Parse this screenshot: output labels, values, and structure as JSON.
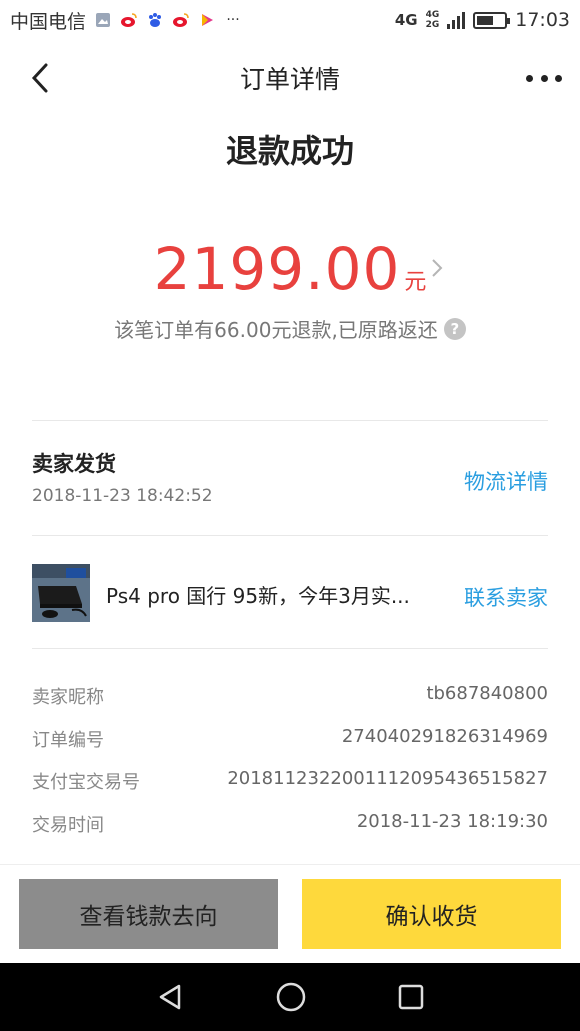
{
  "status_bar": {
    "carrier": "中国电信",
    "network_4g": "4G",
    "network_small_top": "4G",
    "network_small_bottom": "2G",
    "time": "17:03",
    "battery_level": 0.6,
    "notif_icons": [
      "gallery-icon",
      "weibo-icon",
      "baidu-icon",
      "weibo-icon",
      "video-play-icon",
      "more-dots"
    ]
  },
  "nav": {
    "title": "订单详情"
  },
  "order": {
    "status": "退款成功",
    "amount": "2199.00",
    "amount_unit": "元",
    "refund_note": "该笔订单有66.00元退款,已原路返还",
    "help": "?",
    "ship_label": "卖家发货",
    "ship_time": "2018-11-23 18:42:52",
    "logistics_link": "物流详情",
    "product_title": "Ps4 pro 国行 95新，今年3月实...",
    "contact_link": "联系卖家"
  },
  "info": [
    {
      "label": "卖家昵称",
      "value": "tb687840800"
    },
    {
      "label": "订单编号",
      "value": "274040291826314969"
    },
    {
      "label": "支付宝交易号",
      "value": "2018112322001112095436515827"
    },
    {
      "label": "交易时间",
      "value": "2018-11-23 18:19:30"
    }
  ],
  "buttons": {
    "view_funds": "查看钱款去向",
    "confirm_receipt": "确认收货"
  },
  "colors": {
    "accent_red": "#e8413e",
    "link_blue": "#2a9ee0",
    "confirm_yellow": "#fed93c",
    "secondary_grey": "#8c8c8c"
  }
}
